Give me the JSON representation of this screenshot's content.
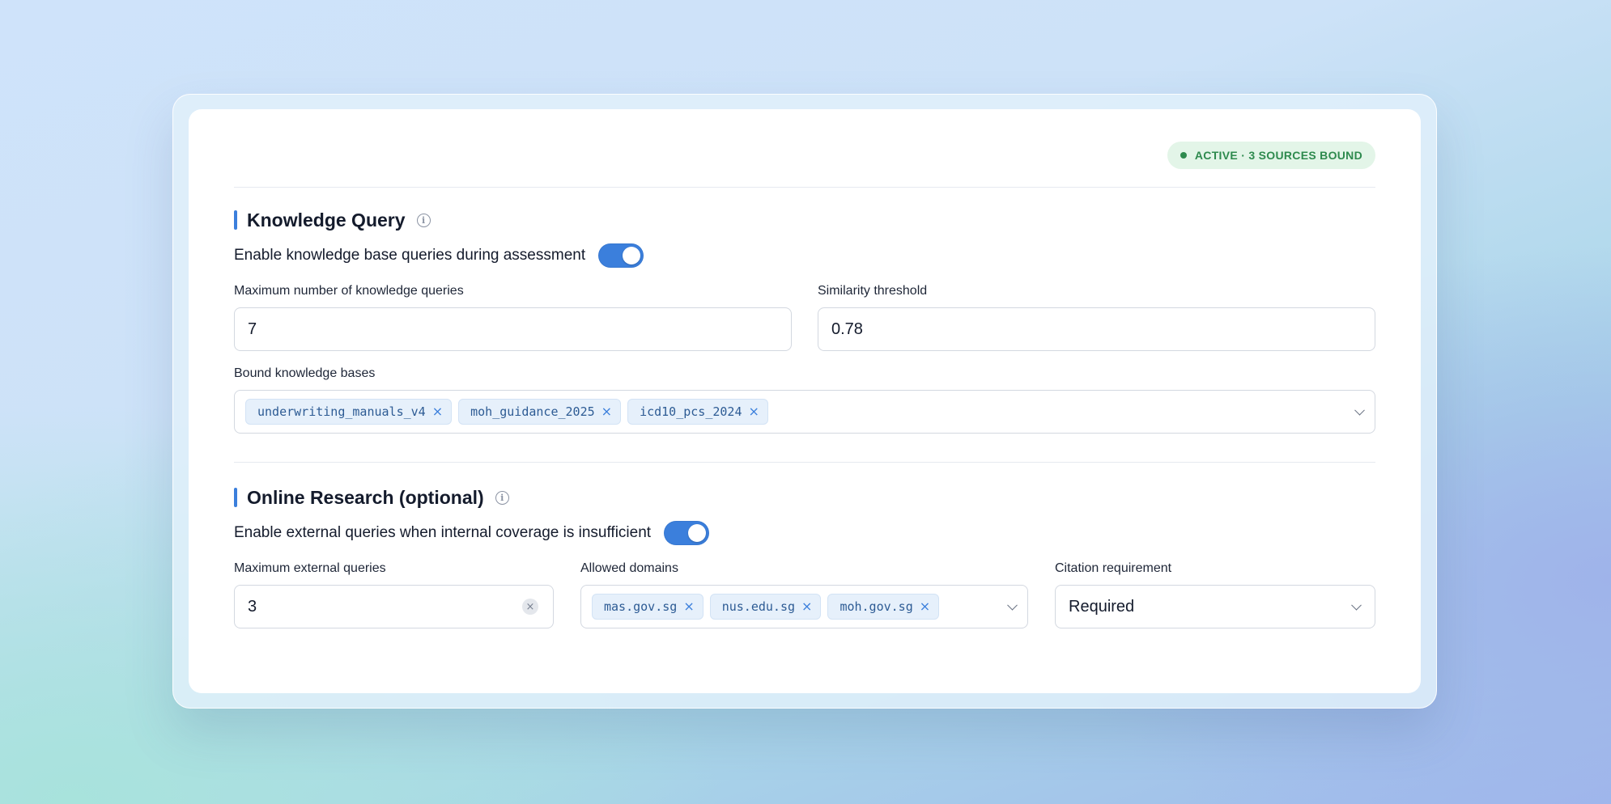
{
  "status_badge": "ACTIVE · 3 SOURCES BOUND",
  "knowledge_query": {
    "title": "Knowledge Query",
    "toggle_label": "Enable knowledge base queries during assessment",
    "toggle_on": true,
    "max_queries_label": "Maximum number of knowledge queries",
    "max_queries_value": "7",
    "similarity_label": "Similarity threshold",
    "similarity_value": "0.78",
    "bound_label": "Bound knowledge bases",
    "bound_bases": [
      "underwriting_manuals_v4",
      "moh_guidance_2025",
      "icd10_pcs_2024"
    ]
  },
  "online_research": {
    "title": "Online Research (optional)",
    "toggle_label": "Enable external queries when internal coverage is insufficient",
    "toggle_on": true,
    "max_external_label": "Maximum external queries",
    "max_external_value": "3",
    "domains_label": "Allowed domains",
    "domains": [
      "mas.gov.sg",
      "nus.edu.sg",
      "moh.gov.sg"
    ],
    "citation_label": "Citation requirement",
    "citation_value": "Required"
  },
  "icons": {
    "info": "info-circle-icon",
    "remove": "x-icon",
    "dropdown": "chevron-down-icon",
    "clear": "clear-icon"
  },
  "colors": {
    "accent": "#3b7fdc",
    "status_green": "#2e8a4e",
    "status_bg": "#e3f5e8",
    "chip_bg": "#e6f0fb"
  }
}
